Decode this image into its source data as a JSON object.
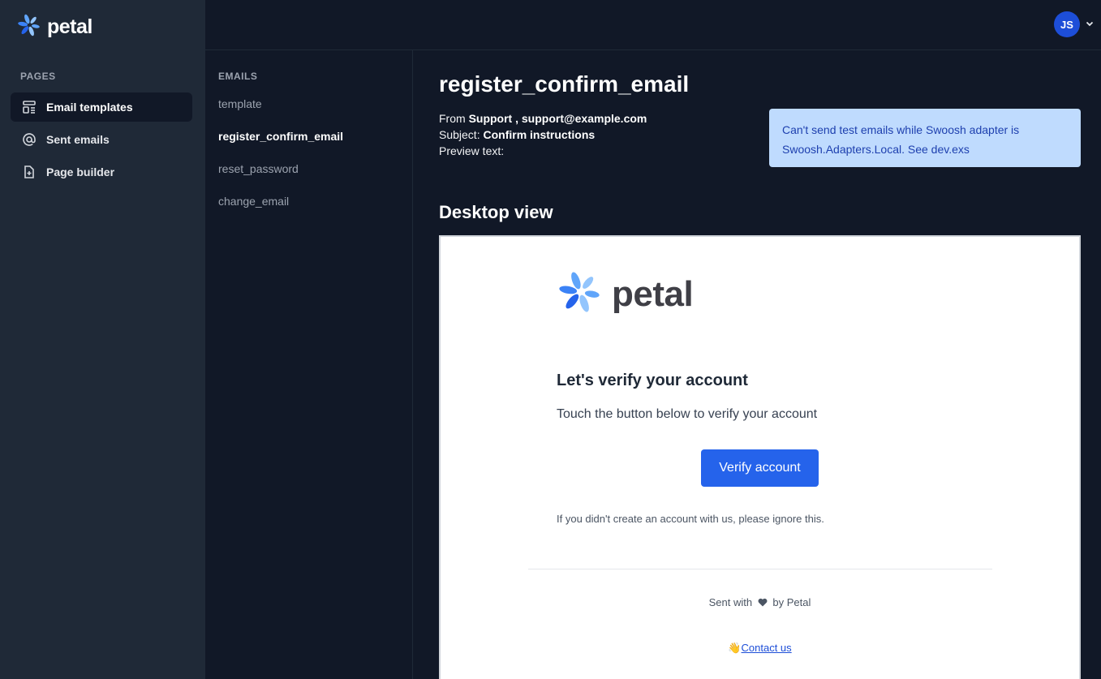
{
  "app": {
    "logo_text": "petal"
  },
  "sidebar": {
    "section_label": "PAGES",
    "items": [
      {
        "label": "Email templates",
        "icon": "template-icon",
        "active": true
      },
      {
        "label": "Sent emails",
        "icon": "at-sign-icon",
        "active": false
      },
      {
        "label": "Page builder",
        "icon": "document-add-icon",
        "active": false
      }
    ]
  },
  "user": {
    "initials": "JS"
  },
  "emails": {
    "section_label": "EMAILS",
    "items": [
      "template",
      "register_confirm_email",
      "reset_password",
      "change_email"
    ],
    "active": "register_confirm_email"
  },
  "main": {
    "title": "register_confirm_email",
    "from_label": "From",
    "from_value": "Support , support@example.com",
    "subject_label": "Subject:",
    "subject_value": "Confirm instructions",
    "preview_label": "Preview text:",
    "alert": "Can't send test emails while Swoosh adapter is Swoosh.Adapters.Local. See dev.exs",
    "section_title": "Desktop view"
  },
  "preview": {
    "logo_text": "petal",
    "heading": "Let's verify your account",
    "body": "Touch the button below to verify your account",
    "button_label": "Verify account",
    "note": "If you didn't create an account with us, please ignore this.",
    "footer_prefix": "Sent with",
    "footer_suffix": "by Petal",
    "contact_emoji": "👋",
    "contact_label": "Contact us"
  },
  "colors": {
    "sidebar_bg": "#1f2937",
    "page_bg": "#111827",
    "accent": "#2563eb",
    "alert_bg": "#bfdbfe",
    "alert_text": "#1e40af"
  }
}
